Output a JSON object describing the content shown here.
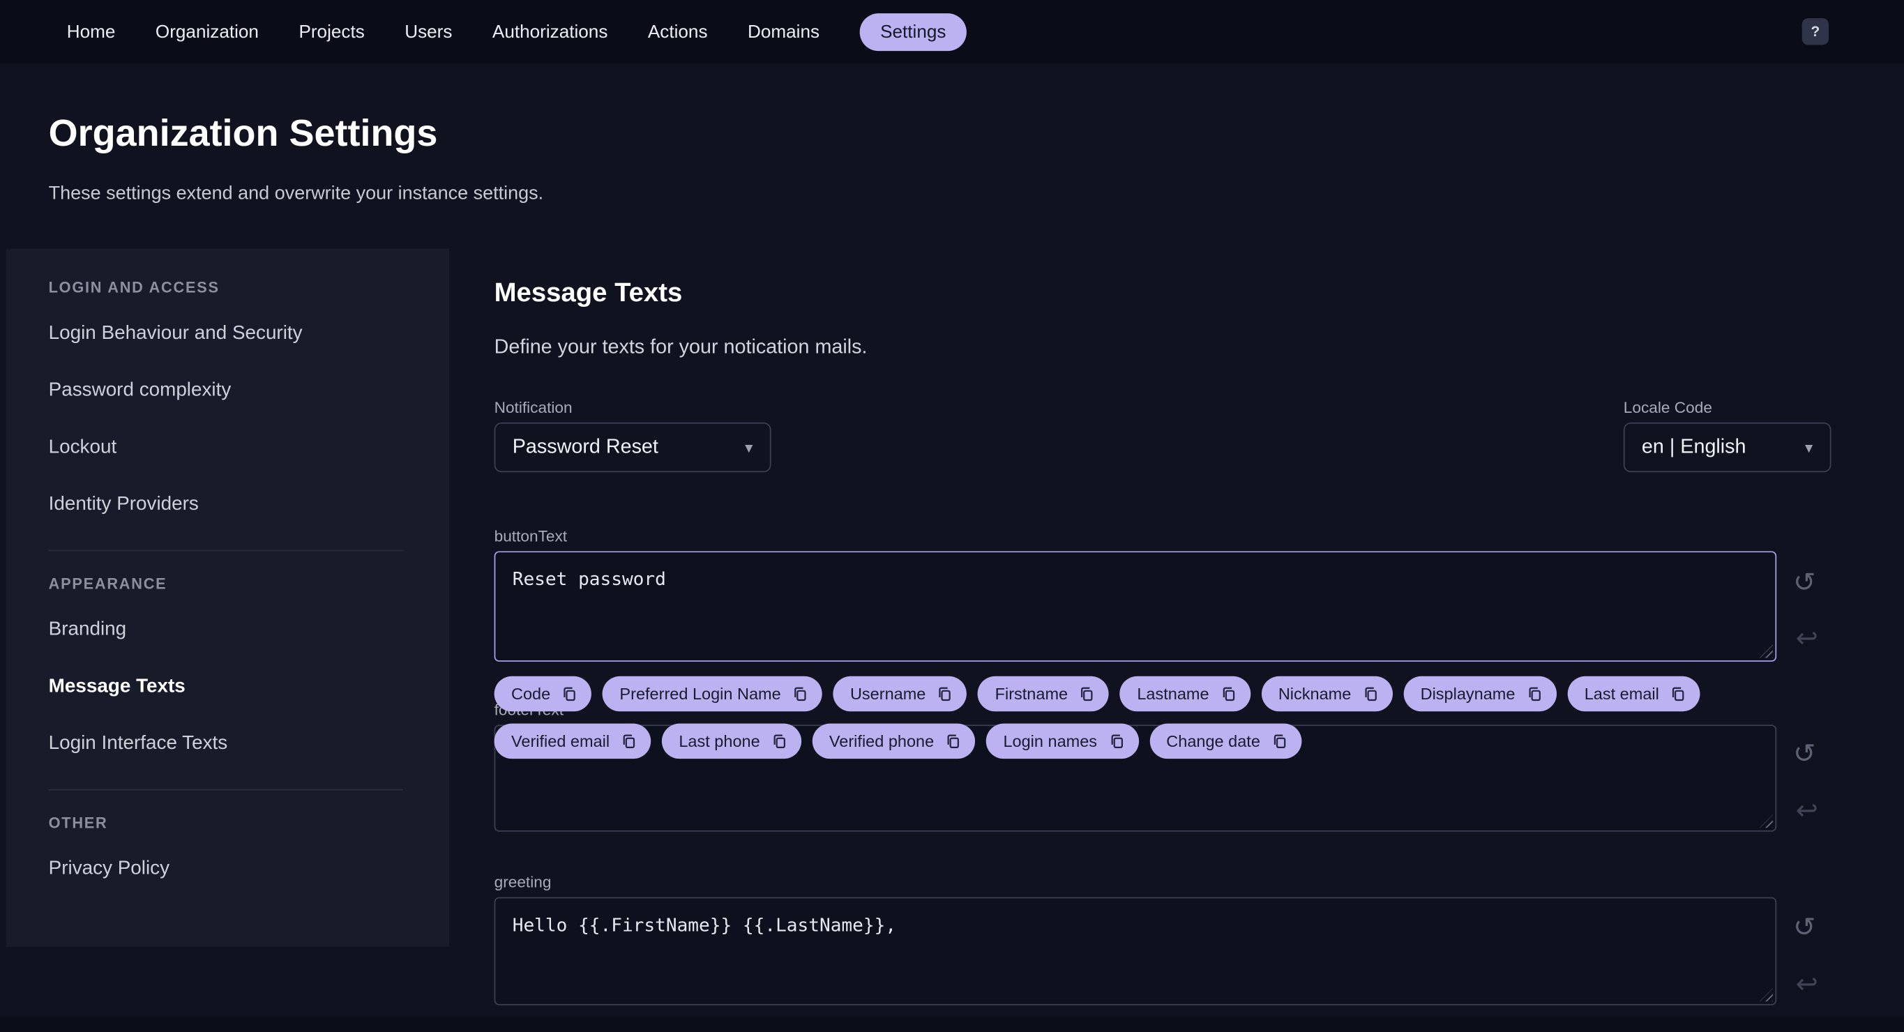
{
  "nav": {
    "items": [
      "Home",
      "Organization",
      "Projects",
      "Users",
      "Authorizations",
      "Actions",
      "Domains",
      "Settings"
    ],
    "active": "Settings",
    "help_label": "?"
  },
  "header": {
    "title": "Organization Settings",
    "subtitle": "These settings extend and overwrite your instance settings."
  },
  "sidebar": {
    "sections": [
      {
        "title": "LOGIN AND ACCESS",
        "items": [
          "Login Behaviour and Security",
          "Password complexity",
          "Lockout",
          "Identity Providers"
        ]
      },
      {
        "title": "APPEARANCE",
        "items": [
          "Branding",
          "Message Texts",
          "Login Interface Texts"
        ]
      },
      {
        "title": "OTHER",
        "items": [
          "Privacy Policy"
        ]
      }
    ],
    "active_item": "Message Texts"
  },
  "main": {
    "heading": "Message Texts",
    "description": "Define your texts for your notication mails.",
    "notification": {
      "label": "Notification",
      "value": "Password Reset"
    },
    "locale": {
      "label": "Locale Code",
      "value": "en | English"
    },
    "button_text": {
      "label": "buttonText",
      "value": "Reset password"
    },
    "footer_text": {
      "label": "footerText",
      "value": ""
    },
    "greeting": {
      "label": "greeting",
      "value": "Hello {{.FirstName}} {{.LastName}},"
    },
    "chips": [
      "Code",
      "Preferred Login Name",
      "Username",
      "Firstname",
      "Lastname",
      "Nickname",
      "Displayname",
      "Last email",
      "Verified email",
      "Last phone",
      "Verified phone",
      "Login names",
      "Change date"
    ]
  },
  "icons": {
    "history": "↺",
    "undo": "↩",
    "dropdown": "▾"
  },
  "colors": {
    "accent": "#bdb2f1",
    "page_bg": "#10131f",
    "nav_bg": "#0a0d18",
    "sidebar_bg": "#181b29",
    "focus_border": "#a9a0ee"
  }
}
